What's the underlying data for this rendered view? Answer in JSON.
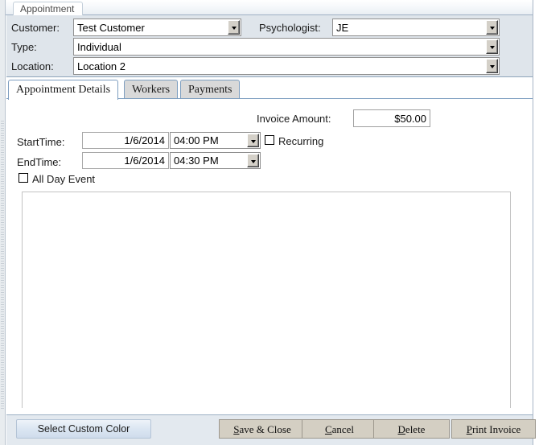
{
  "window": {
    "title": "Appointment"
  },
  "header": {
    "fields": [
      {
        "label": "Customer:",
        "value": "Test Customer",
        "control": "combobox"
      },
      {
        "label": "Psychologist:",
        "value": "JE",
        "control": "combobox"
      },
      {
        "label": "Type:",
        "value": "Individual",
        "control": "combobox"
      },
      {
        "label": "Location:",
        "value": "Location 2",
        "control": "combobox"
      }
    ]
  },
  "tabs": [
    {
      "label": "Appointment Details",
      "active": true
    },
    {
      "label": "Workers",
      "active": false
    },
    {
      "label": "Payments",
      "active": false
    }
  ],
  "details": {
    "invoice_label": "Invoice Amount:",
    "invoice_value": "$50.00",
    "start_label": "StartTime:",
    "start_date": "1/6/2014",
    "start_time": "04:00 PM",
    "end_label": "EndTime:",
    "end_date": "1/6/2014",
    "end_time": "04:30 PM",
    "recurring_label": "Recurring",
    "recurring_checked": false,
    "allday_label": "All Day Event",
    "allday_checked": false,
    "notes_value": "",
    "notes_placeholder": ""
  },
  "footer": {
    "select_color": {
      "label": "Select Custom Color"
    },
    "save_close": {
      "accel": "S",
      "rest": "ave & Close"
    },
    "cancel": {
      "accel": "C",
      "rest": "ancel"
    },
    "delete": {
      "accel": "D",
      "rest": "elete"
    },
    "print_invoice": {
      "accel": "P",
      "rest": "rint Invoice"
    }
  },
  "colors": {
    "header_bg": "#dfe5eb",
    "footer_bg": "#e3e9ef",
    "button_bg": "#d4cfc3",
    "tab_active_bg": "#ffffff",
    "tab_inactive_bg": "#d9d9d9",
    "tab_border": "#7d9ec0"
  }
}
